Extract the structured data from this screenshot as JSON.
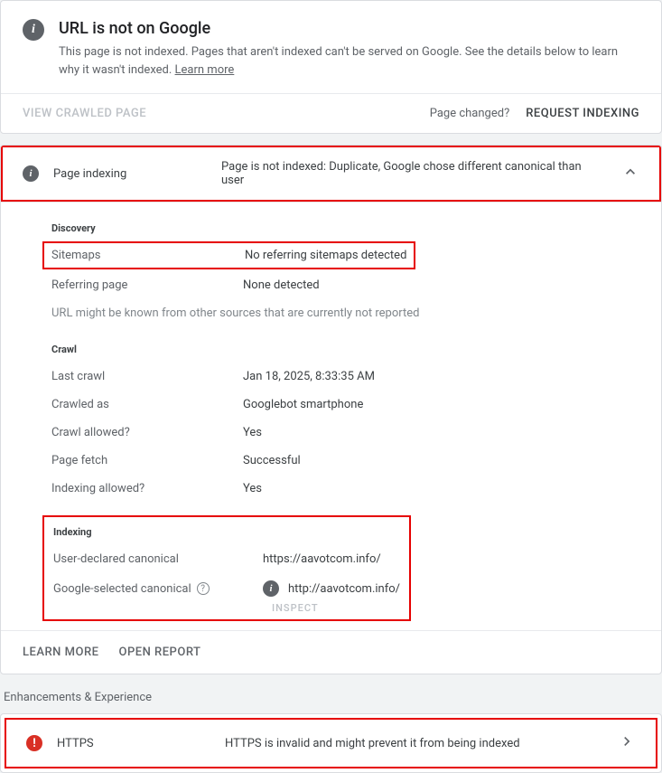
{
  "header": {
    "title": "URL is not on Google",
    "desc": "This page is not indexed. Pages that aren't indexed can't be served on Google. See the details below to learn why it wasn't indexed. ",
    "learn_more": "Learn more",
    "view_crawled": "VIEW CRAWLED PAGE",
    "page_changed": "Page changed?",
    "request_indexing": "REQUEST INDEXING"
  },
  "indexing": {
    "label": "Page indexing",
    "status": "Page is not indexed: Duplicate, Google chose different canonical than user",
    "discovery": {
      "title": "Discovery",
      "sitemaps_k": "Sitemaps",
      "sitemaps_v": "No referring sitemaps detected",
      "ref_k": "Referring page",
      "ref_v": "None detected",
      "note": "URL might be known from other sources that are currently not reported"
    },
    "crawl": {
      "title": "Crawl",
      "last_k": "Last crawl",
      "last_v": "Jan 18, 2025, 8:33:35 AM",
      "as_k": "Crawled as",
      "as_v": "Googlebot smartphone",
      "allowed_k": "Crawl allowed?",
      "allowed_v": "Yes",
      "fetch_k": "Page fetch",
      "fetch_v": "Successful",
      "idx_k": "Indexing allowed?",
      "idx_v": "Yes"
    },
    "idx_section": {
      "title": "Indexing",
      "user_k": "User-declared canonical",
      "user_v": "https://aavotcom.info/",
      "google_k": "Google-selected canonical",
      "google_v": "http://aavotcom.info/",
      "inspect": "INSPECT"
    },
    "learn_more": "LEARN MORE",
    "open_report": "OPEN REPORT"
  },
  "enhancements_heading": "Enhancements & Experience",
  "https": {
    "label": "HTTPS",
    "status": "HTTPS is invalid and might prevent it from being indexed"
  }
}
